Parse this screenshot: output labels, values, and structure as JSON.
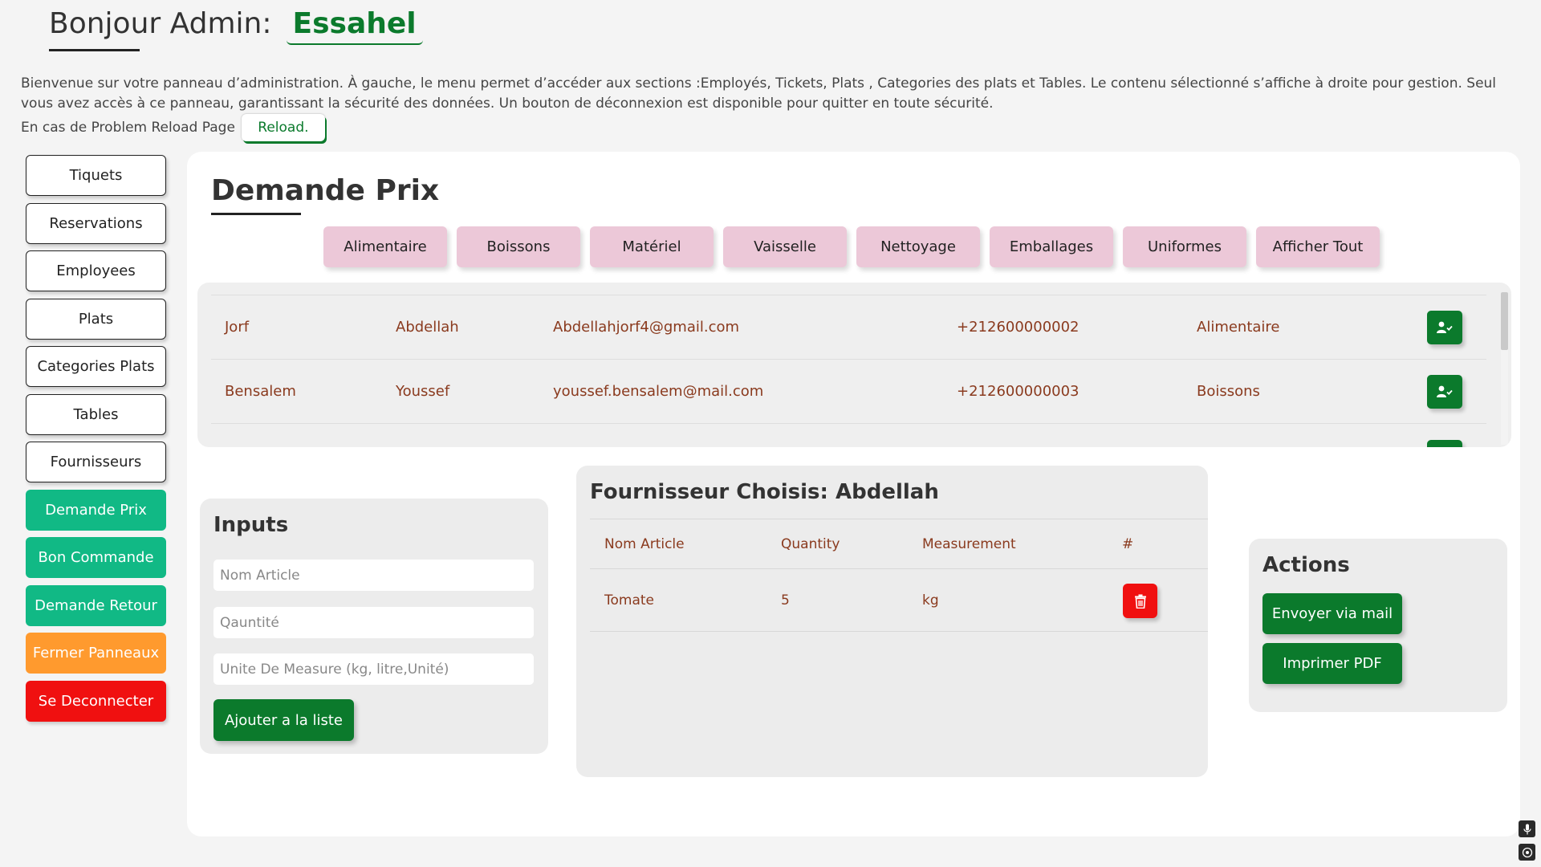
{
  "header": {
    "greeting": "Bonjour Admin:",
    "name": "Essahel",
    "intro": "Bienvenue sur votre panneau d’administration. À gauche, le menu permet d’accéder aux sections :Employés, Tickets, Plats , Categories des plats et Tables. Le contenu sélectionné s’affiche à droite pour gestion. Seul vous avez accès à ce panneau, garantissant la sécurité des données. Un bouton de déconnexion est disponible pour quitter en toute sécurité.",
    "reload_text": "En cas de Problem Reload Page",
    "reload_label": "Reload."
  },
  "sidebar": {
    "items": [
      {
        "label": "Tiquets"
      },
      {
        "label": "Reservations"
      },
      {
        "label": "Employees"
      },
      {
        "label": "Plats"
      },
      {
        "label": "Categories Plats"
      },
      {
        "label": "Tables"
      },
      {
        "label": "Fournisseurs"
      },
      {
        "label": "Demande Prix"
      },
      {
        "label": "Bon Commande"
      },
      {
        "label": "Demande Retour"
      },
      {
        "label": "Fermer Panneaux"
      },
      {
        "label": "Se Deconnecter"
      }
    ]
  },
  "main": {
    "title": "Demande Prix",
    "categories": [
      "Alimentaire",
      "Boissons",
      "Matériel",
      "Vaisselle",
      "Nettoyage",
      "Emballages",
      "Uniformes",
      "Afficher Tout"
    ],
    "suppliers": [
      {
        "last": "Jorf",
        "first": "Abdellah",
        "email": "Abdellahjorf4@gmail.com",
        "phone": "+212600000002",
        "category": "Alimentaire"
      },
      {
        "last": "Bensalem",
        "first": "Youssef",
        "email": "youssef.bensalem@mail.com",
        "phone": "+212600000003",
        "category": "Boissons"
      }
    ]
  },
  "inputs": {
    "title": "Inputs",
    "article_placeholder": "Nom Article",
    "quantity_placeholder": "Qauntité",
    "unit_placeholder": "Unite De Measure (kg, litre,Unité)",
    "add_label": "Ajouter a la liste"
  },
  "chosen": {
    "title": "Fournisseur Choisis: Abdellah",
    "headers": [
      "Nom Article",
      "Quantity",
      "Measurement",
      "#"
    ],
    "rows": [
      {
        "article": "Tomate",
        "quantity": "5",
        "measurement": "kg"
      }
    ]
  },
  "actions": {
    "title": "Actions",
    "mail_label": "Envoyer via mail",
    "pdf_label": "Imprimer PDF"
  },
  "colors": {
    "green": "#0b7a2c",
    "teal": "#11b985",
    "orange": "#ff9a2e",
    "red": "#f01010",
    "pink": "#ecc8d8",
    "text_brown": "#8a3a1e"
  }
}
